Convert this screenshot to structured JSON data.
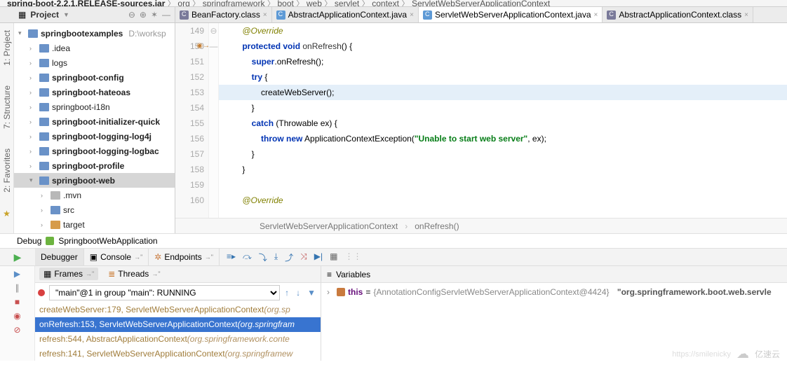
{
  "breadcrumb": {
    "jar": "spring-boot-2.2.1.RELEASE-sources.jar",
    "parts": [
      "org",
      "springframework",
      "boot",
      "web",
      "servlet",
      "context",
      "ServletWebServerApplicationContext"
    ]
  },
  "projectPane": {
    "title": "Project",
    "root": "springbootexamples",
    "rootPath": "D:\\worksp",
    "items": [
      {
        "label": ".idea",
        "depth": 1
      },
      {
        "label": "logs",
        "depth": 1
      },
      {
        "label": "springboot-config",
        "depth": 1,
        "bold": true
      },
      {
        "label": "springboot-hateoas",
        "depth": 1,
        "bold": true
      },
      {
        "label": "springboot-i18n",
        "depth": 1
      },
      {
        "label": "springboot-initializer-quick",
        "depth": 1,
        "bold": true
      },
      {
        "label": "springboot-logging-log4j",
        "depth": 1,
        "bold": true
      },
      {
        "label": "springboot-logging-logbac",
        "depth": 1,
        "bold": true
      },
      {
        "label": "springboot-profile",
        "depth": 1,
        "bold": true
      },
      {
        "label": "springboot-web",
        "depth": 1,
        "bold": true,
        "selected": true,
        "expanded": true
      },
      {
        "label": ".mvn",
        "depth": 2,
        "gray": true
      },
      {
        "label": "src",
        "depth": 2
      },
      {
        "label": "target",
        "depth": 2,
        "orange": true
      }
    ]
  },
  "sideBars": {
    "project": "1: Project",
    "structure": "7: Structure",
    "favorites": "2: Favorites"
  },
  "tabs": [
    {
      "label": "BeanFactory.class",
      "type": "cls"
    },
    {
      "label": "AbstractApplicationContext.java",
      "type": "java"
    },
    {
      "label": "ServletWebServerApplicationContext.java",
      "type": "java",
      "active": true
    },
    {
      "label": "AbstractApplicationContext.class",
      "type": "cls"
    }
  ],
  "editor": {
    "startLine": 149,
    "highlightLine": 153,
    "lines": [
      {
        "n": 149,
        "html": "<span class='ann'>@Override</span>"
      },
      {
        "n": 150,
        "html": "<span class='kw'>protected void</span> <span class='mtd'>onRefresh</span>() {",
        "arrow": true
      },
      {
        "n": 151,
        "html": "    <span class='kw'>super</span>.onRefresh();"
      },
      {
        "n": 152,
        "html": "    <span class='kw'>try</span> {"
      },
      {
        "n": 153,
        "html": "        createWebServer();",
        "hl": true
      },
      {
        "n": 154,
        "html": "    }"
      },
      {
        "n": 155,
        "html": "    <span class='kw'>catch</span> (Throwable ex) {"
      },
      {
        "n": 156,
        "html": "        <span class='kw'>throw new</span> ApplicationContextException(<span class='str'>\"Unable to start web server\"</span>, ex);"
      },
      {
        "n": 157,
        "html": "    }"
      },
      {
        "n": 158,
        "html": "}"
      },
      {
        "n": 159,
        "html": ""
      },
      {
        "n": 160,
        "html": "<span class='ann'>@Override</span>"
      }
    ],
    "pathBar": {
      "cls": "ServletWebServerApplicationContext",
      "method": "onRefresh()"
    }
  },
  "debug": {
    "runConfig": "SpringbootWebApplication",
    "label": "Debug",
    "tabs": {
      "debugger": "Debugger",
      "console": "Console",
      "endpoints": "Endpoints"
    },
    "framesTab": "Frames",
    "threadsTab": "Threads",
    "threadSelect": "\"main\"@1 in group \"main\": RUNNING",
    "stack": [
      {
        "loc": "createWebServer:179, ServletWebServerApplicationContext",
        "pkg": "(org.sp",
        "lib": true
      },
      {
        "loc": "onRefresh:153, ServletWebServerApplicationContext",
        "pkg": "(org.springfram",
        "selected": true
      },
      {
        "loc": "refresh:544, AbstractApplicationContext",
        "pkg": "(org.springframework.conte",
        "lib": true
      },
      {
        "loc": "refresh:141, ServletWebServerApplicationContext",
        "pkg": "(org.springframew",
        "lib": true
      }
    ],
    "variablesTitle": "Variables",
    "variable": {
      "name": "this",
      "eq": " = ",
      "summary": "{AnnotationConfigServletWebServerApplicationContext@4424}",
      "str": "\"org.springframework.boot.web.servle"
    }
  },
  "watermark": {
    "url": "https://smilenicky",
    "brand": "亿速云"
  }
}
